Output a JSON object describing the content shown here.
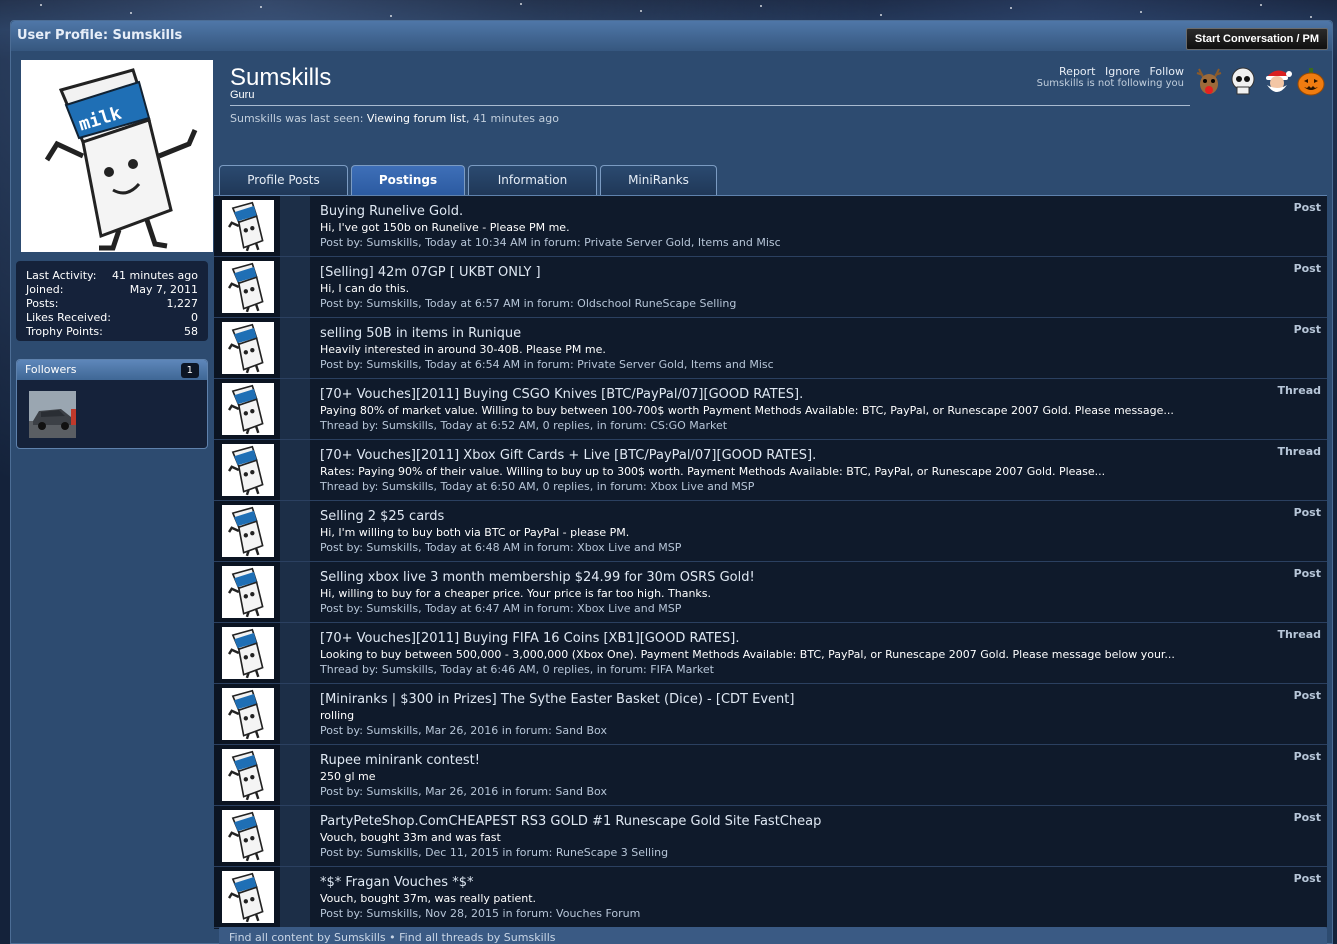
{
  "header": {
    "title": "User Profile: Sumskills",
    "pm_button": "Start Conversation / PM"
  },
  "profile": {
    "username": "Sumskills",
    "user_title": "Guru",
    "last_seen_prefix": "Sumskills was last seen:",
    "last_seen_activity": "Viewing forum list",
    "last_seen_time": ", 41 minutes ago",
    "actions": {
      "report": "Report",
      "ignore": "Ignore",
      "follow": "Follow"
    },
    "follow_note": "Sumskills is not following you",
    "badges": [
      "reindeer-icon",
      "skull-icon",
      "santa-icon",
      "pumpkin-icon"
    ]
  },
  "stats": [
    {
      "label": "Last Activity:",
      "value": "41 minutes ago"
    },
    {
      "label": "Joined:",
      "value": "May 7, 2011"
    },
    {
      "label": "Posts:",
      "value": "1,227"
    },
    {
      "label": "Likes Received:",
      "value": "0"
    },
    {
      "label": "Trophy Points:",
      "value": "58"
    }
  ],
  "followers": {
    "label": "Followers",
    "count": "1"
  },
  "tabs": [
    {
      "label": "Profile Posts",
      "active": false
    },
    {
      "label": "Postings",
      "active": true
    },
    {
      "label": "Information",
      "active": false
    },
    {
      "label": "MiniRanks",
      "active": false
    }
  ],
  "postings": [
    {
      "title": "Buying Runelive Gold.",
      "snippet": "Hi, I've got 150b on Runelive - Please PM me.",
      "meta": "Post by: Sumskills, Today at 10:34 AM in forum: Private Server Gold, Items and Misc",
      "type": "Post"
    },
    {
      "title": "[Selling] 42m 07GP [ UKBT ONLY ]",
      "snippet": "Hi, I can do this.",
      "meta": "Post by: Sumskills, Today at 6:57 AM in forum: Oldschool RuneScape Selling",
      "type": "Post"
    },
    {
      "title": "selling 50B in items in Runique",
      "snippet": "Heavily interested in around 30-40B. Please PM me.",
      "meta": "Post by: Sumskills, Today at 6:54 AM in forum: Private Server Gold, Items and Misc",
      "type": "Post"
    },
    {
      "title": "[70+ Vouches][2011] Buying CSGO Knives [BTC/PayPal/07][GOOD RATES].",
      "snippet": "Paying 80% of market value. Willing to buy between 100-700$ worth Payment Methods Available: BTC, PayPal, or Runescape 2007 Gold. Please message...",
      "meta": "Thread by: Sumskills, Today at 6:52 AM, 0 replies, in forum: CS:GO Market",
      "type": "Thread"
    },
    {
      "title": "[70+ Vouches][2011] Xbox Gift Cards + Live [BTC/PayPal/07][GOOD RATES].",
      "snippet": "Rates: Paying 90% of their value. Willing to buy up to 300$ worth. Payment Methods Available: BTC, PayPal, or Runescape 2007 Gold. Please...",
      "meta": "Thread by: Sumskills, Today at 6:50 AM, 0 replies, in forum: Xbox Live and MSP",
      "type": "Thread"
    },
    {
      "title": "Selling 2 $25 cards",
      "snippet": "Hi, I'm willing to buy both via BTC or PayPal - please PM.",
      "meta": "Post by: Sumskills, Today at 6:48 AM in forum: Xbox Live and MSP",
      "type": "Post"
    },
    {
      "title": "Selling xbox live 3 month membership $24.99 for 30m OSRS Gold!",
      "snippet": "Hi, willing to buy for a cheaper price. Your price is far too high. Thanks.",
      "meta": "Post by: Sumskills, Today at 6:47 AM in forum: Xbox Live and MSP",
      "type": "Post"
    },
    {
      "title": "[70+ Vouches][2011] Buying FIFA 16 Coins [XB1][GOOD RATES].",
      "snippet": "Looking to buy between 500,000 - 3,000,000 (Xbox One). Payment Methods Available: BTC, PayPal, or Runescape 2007 Gold. Please message below your...",
      "meta": "Thread by: Sumskills, Today at 6:46 AM, 0 replies, in forum: FIFA Market",
      "type": "Thread"
    },
    {
      "title": "[Miniranks | $300 in Prizes] The Sythe Easter Basket (Dice) - [CDT Event]",
      "snippet": "rolling",
      "meta": "Post by: Sumskills, Mar 26, 2016 in forum: Sand Box",
      "type": "Post"
    },
    {
      "title": "Rupee minirank contest!",
      "snippet": "250 gl me",
      "meta": "Post by: Sumskills, Mar 26, 2016 in forum: Sand Box",
      "type": "Post"
    },
    {
      "title": "PartyPeteShop.ComCHEAPEST RS3 GOLD #1 Runescape Gold Site FastCheap",
      "snippet": "Vouch, bought 33m and was fast",
      "meta": "Post by: Sumskills, Dec 11, 2015 in forum: RuneScape 3 Selling",
      "type": "Post"
    },
    {
      "title": "*$* Fragan Vouches *$*",
      "snippet": "Vouch, bought 37m, was really patient.",
      "meta": "Post by: Sumskills, Nov 28, 2015 in forum: Vouches Forum",
      "type": "Post"
    }
  ],
  "footer": {
    "find_content": "Find all content by Sumskills",
    "separator": "•",
    "find_threads": "Find all threads by Sumskills"
  },
  "colors": {
    "accent": "#2b5aa0",
    "panel": "#0f1a2b",
    "frame": "#2d4b70"
  }
}
